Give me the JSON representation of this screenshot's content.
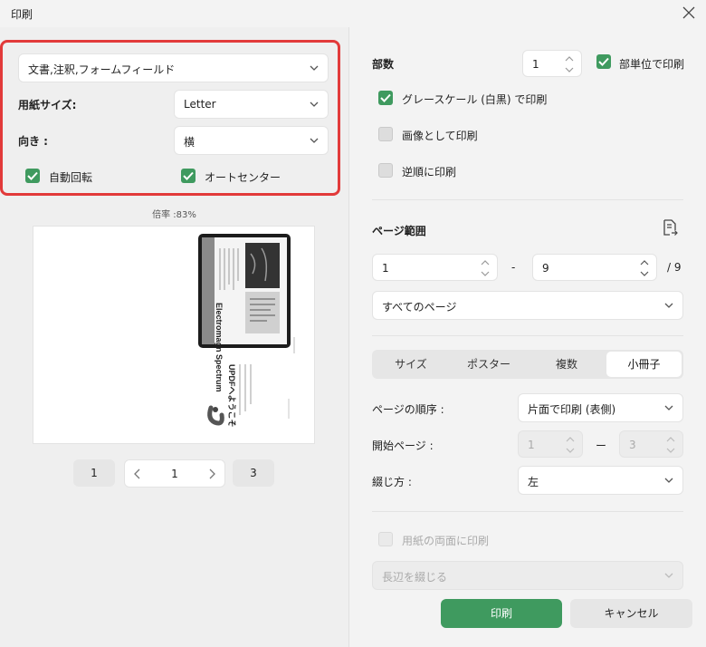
{
  "window": {
    "title": "印刷"
  },
  "left": {
    "content_select": "文書,注釈,フォームフィールド",
    "paper_size_label": "用紙サイズ:",
    "paper_size_value": "Letter",
    "orientation_label": "向き :",
    "orientation_value": "横",
    "auto_rotate_label": "自動回転",
    "auto_center_label": "オートセンター",
    "zoom_text": "倍率 :83%"
  },
  "preview": {
    "spine_title": "Electromagn Spectrum",
    "welcome_title": "UPDFへようこそ"
  },
  "pager": {
    "first": "1",
    "current": "1",
    "last": "3"
  },
  "right": {
    "copies_label": "部数",
    "copies_value": "1",
    "collate_label": "部単位で印刷",
    "grayscale_label": "グレースケール (白黒) で印刷",
    "as_image_label": "画像として印刷",
    "reverse_label": "逆順に印刷",
    "page_range_label": "ページ範囲",
    "range_from": "1",
    "range_dash": "-",
    "range_to": "9",
    "range_total": "/ 9",
    "pages_select": "すべてのページ",
    "tabs": [
      "サイズ",
      "ポスター",
      "複数",
      "小冊子"
    ],
    "page_order_label": "ページの順序 :",
    "page_order_value": "片面で印刷 (表側)",
    "start_page_label": "開始ページ :",
    "start_page_from": "1",
    "start_page_dash": "ー",
    "start_page_to": "3",
    "binding_label": "綴じ方 :",
    "binding_value": "左",
    "duplex_label": "用紙の両面に印刷",
    "long_edge_select": "長辺を綴じる",
    "print_button": "印刷",
    "cancel_button": "キャンセル"
  },
  "colors": {
    "accent": "#3f9a5f",
    "highlight": "#e23a3a"
  }
}
